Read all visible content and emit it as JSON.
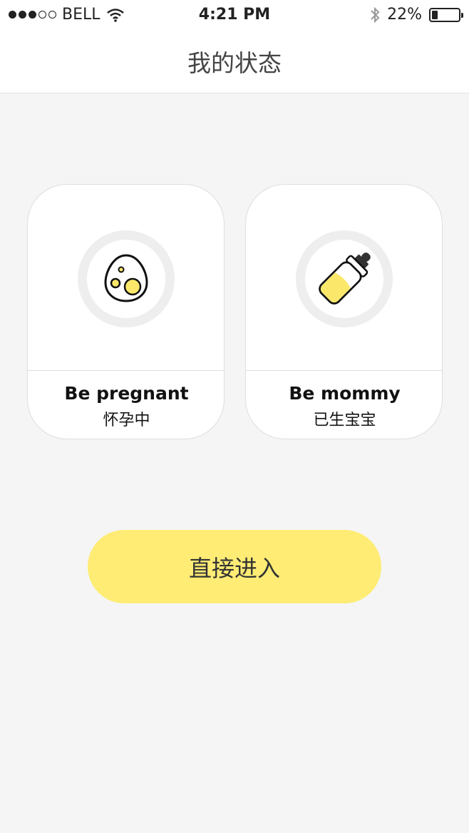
{
  "status_bar": {
    "carrier": "BELL",
    "time": "4:21 PM",
    "battery": "22%",
    "battery_level": 0.22,
    "signal_bars": 3,
    "signal_total": 5
  },
  "nav": {
    "title": "我的状态"
  },
  "options": [
    {
      "title_en": "Be pregnant",
      "title_cn": "怀孕中",
      "icon": "egg-icon"
    },
    {
      "title_en": "Be mommy",
      "title_cn": "已生宝宝",
      "icon": "baby-bottle-icon"
    }
  ],
  "enter_button": {
    "label": "直接进入"
  },
  "colors": {
    "accent": "#feec75",
    "icon_fill": "#fbe86a",
    "ring": "#eeeeee",
    "background": "#f5f5f5"
  }
}
